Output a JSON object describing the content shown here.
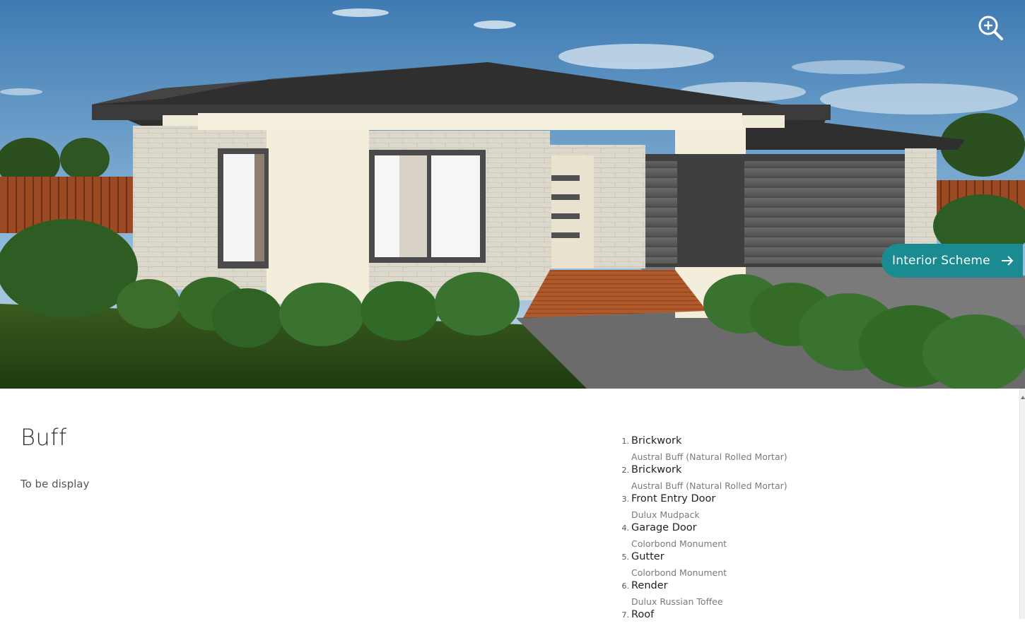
{
  "hero": {
    "image_alt": "Facade render of single-storey brick home with double garage",
    "zoom_icon": "zoom-in-icon",
    "interior_button": {
      "label": "Interior Scheme",
      "icon": "arrow-right-icon"
    }
  },
  "scheme": {
    "title": "Buff",
    "description": "To be display"
  },
  "specs": [
    {
      "num": "1.",
      "name": "Brickwork",
      "value": "Austral Buff (Natural Rolled Mortar)"
    },
    {
      "num": "2.",
      "name": "Brickwork",
      "value": "Austral Buff (Natural Rolled Mortar)"
    },
    {
      "num": "3.",
      "name": "Front Entry Door",
      "value": "Dulux Mudpack"
    },
    {
      "num": "4.",
      "name": "Garage Door",
      "value": "Colorbond Monument"
    },
    {
      "num": "5.",
      "name": "Gutter",
      "value": "Colorbond Monument"
    },
    {
      "num": "6.",
      "name": "Render",
      "value": "Dulux Russian Toffee"
    },
    {
      "num": "7.",
      "name": "Roof",
      "value": ""
    }
  ],
  "colors": {
    "accent": "#1a8b91",
    "sky": "#5b8fbf",
    "roof": "#333333",
    "render": "#f3eddc",
    "brick": "#ddd8cc",
    "garage": "#5e5e5e"
  }
}
